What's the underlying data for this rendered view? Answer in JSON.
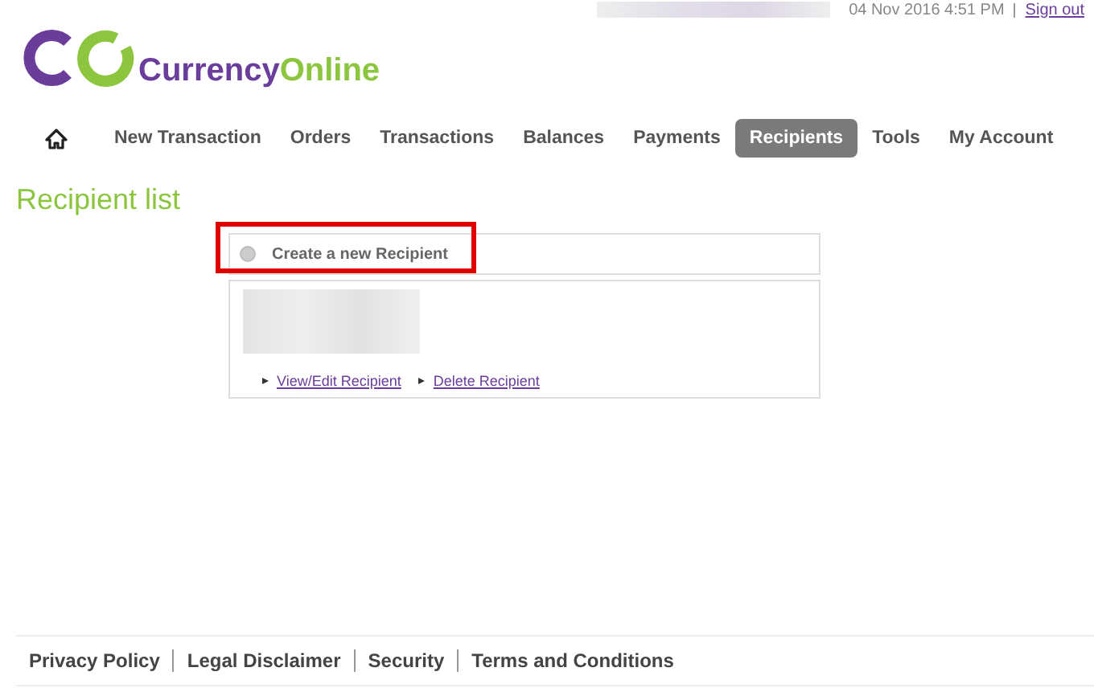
{
  "header": {
    "session_info": "04 Nov 2016 4:51 PM",
    "sign_out": "Sign out",
    "logo": {
      "part_1": "Currency",
      "part_2": "Online"
    }
  },
  "nav": [
    {
      "label": "New Transaction",
      "selected": false
    },
    {
      "label": "Orders",
      "selected": false
    },
    {
      "label": "Transactions",
      "selected": false
    },
    {
      "label": "Balances",
      "selected": false
    },
    {
      "label": "Payments",
      "selected": false
    },
    {
      "label": "Recipients",
      "selected": true
    },
    {
      "label": "Tools",
      "selected": false
    },
    {
      "label": "My Account",
      "selected": false
    }
  ],
  "page_title": "Recipient list",
  "create_option": {
    "label": "Create a new Recipient",
    "selected": false,
    "highlighted": true
  },
  "recipient": {
    "actions": [
      "View/Edit Recipient",
      "Delete Recipient"
    ]
  },
  "footer": [
    "Privacy Policy",
    "Legal Disclaimer",
    "Security",
    "Terms and Conditions"
  ]
}
